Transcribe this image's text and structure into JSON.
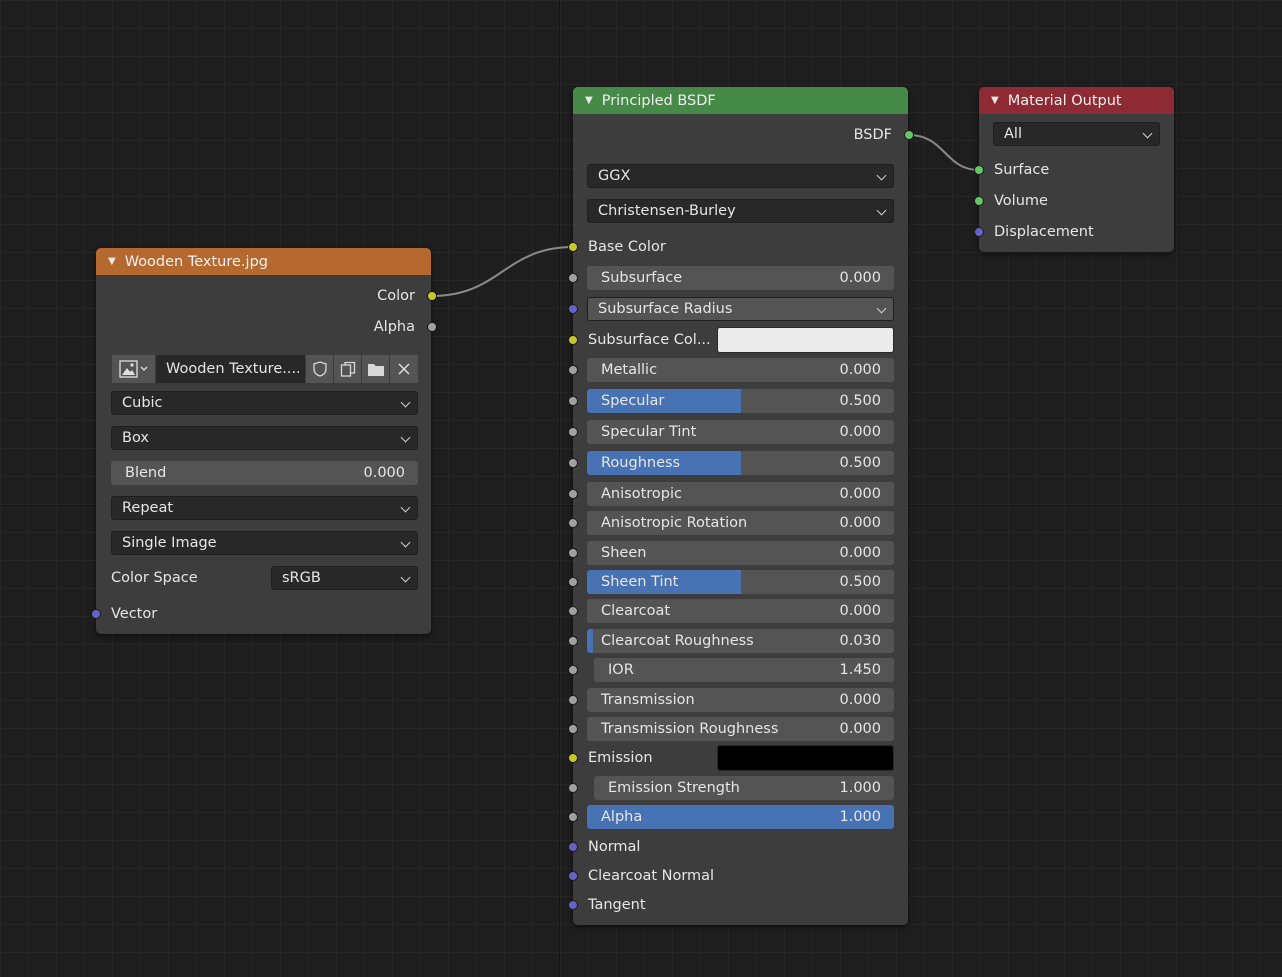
{
  "colors": {
    "texture_header": "#b5692e",
    "bsdf_header": "#458b47",
    "output_header": "#8e2a33",
    "socket_color": "#c7c729",
    "socket_float": "#a1a1a1",
    "socket_vector": "#6363c7",
    "socket_shader": "#63c763",
    "slider_fill": "#4772b3"
  },
  "texture_node": {
    "title": "Wooden Texture.jpg",
    "outputs": {
      "color": "Color",
      "alpha": "Alpha"
    },
    "image_name": "Wooden Texture....",
    "interpolation": "Cubic",
    "projection": "Box",
    "blend": {
      "label": "Blend",
      "value": "0.000"
    },
    "extension": "Repeat",
    "source": "Single Image",
    "color_space": {
      "label": "Color Space",
      "value": "sRGB"
    },
    "vector_input": "Vector"
  },
  "bsdf_node": {
    "title": "Principled BSDF",
    "output": "BSDF",
    "distribution": "GGX",
    "subsurface_method": "Christensen-Burley",
    "base_color": "Base Color",
    "subsurface": {
      "label": "Subsurface",
      "value": "0.000"
    },
    "subsurface_radius": "Subsurface Radius",
    "subsurface_color": {
      "label": "Subsurface Col...",
      "swatch": "#ebebeb"
    },
    "metallic": {
      "label": "Metallic",
      "value": "0.000",
      "fraction": 0
    },
    "specular": {
      "label": "Specular",
      "value": "0.500",
      "fraction": 0.5
    },
    "specular_tint": {
      "label": "Specular Tint",
      "value": "0.000",
      "fraction": 0
    },
    "roughness": {
      "label": "Roughness",
      "value": "0.500",
      "fraction": 0.5
    },
    "anisotropic": {
      "label": "Anisotropic",
      "value": "0.000",
      "fraction": 0
    },
    "anisotropic_rotation": {
      "label": "Anisotropic Rotation",
      "value": "0.000",
      "fraction": 0
    },
    "sheen": {
      "label": "Sheen",
      "value": "0.000",
      "fraction": 0
    },
    "sheen_tint": {
      "label": "Sheen Tint",
      "value": "0.500",
      "fraction": 0.5
    },
    "clearcoat": {
      "label": "Clearcoat",
      "value": "0.000",
      "fraction": 0
    },
    "clearcoat_roughness": {
      "label": "Clearcoat Roughness",
      "value": "0.030",
      "fraction": 0.03
    },
    "ior": {
      "label": "IOR",
      "value": "1.450"
    },
    "transmission": {
      "label": "Transmission",
      "value": "0.000",
      "fraction": 0
    },
    "transmission_roughness": {
      "label": "Transmission Roughness",
      "value": "0.000",
      "fraction": 0
    },
    "emission": {
      "label": "Emission",
      "swatch": "#000000"
    },
    "emission_strength": {
      "label": "Emission Strength",
      "value": "1.000"
    },
    "alpha": {
      "label": "Alpha",
      "value": "1.000",
      "fraction": 1
    },
    "normal": "Normal",
    "clearcoat_normal": "Clearcoat Normal",
    "tangent": "Tangent"
  },
  "output_node": {
    "title": "Material Output",
    "target": "All",
    "surface": "Surface",
    "volume": "Volume",
    "displacement": "Displacement"
  }
}
